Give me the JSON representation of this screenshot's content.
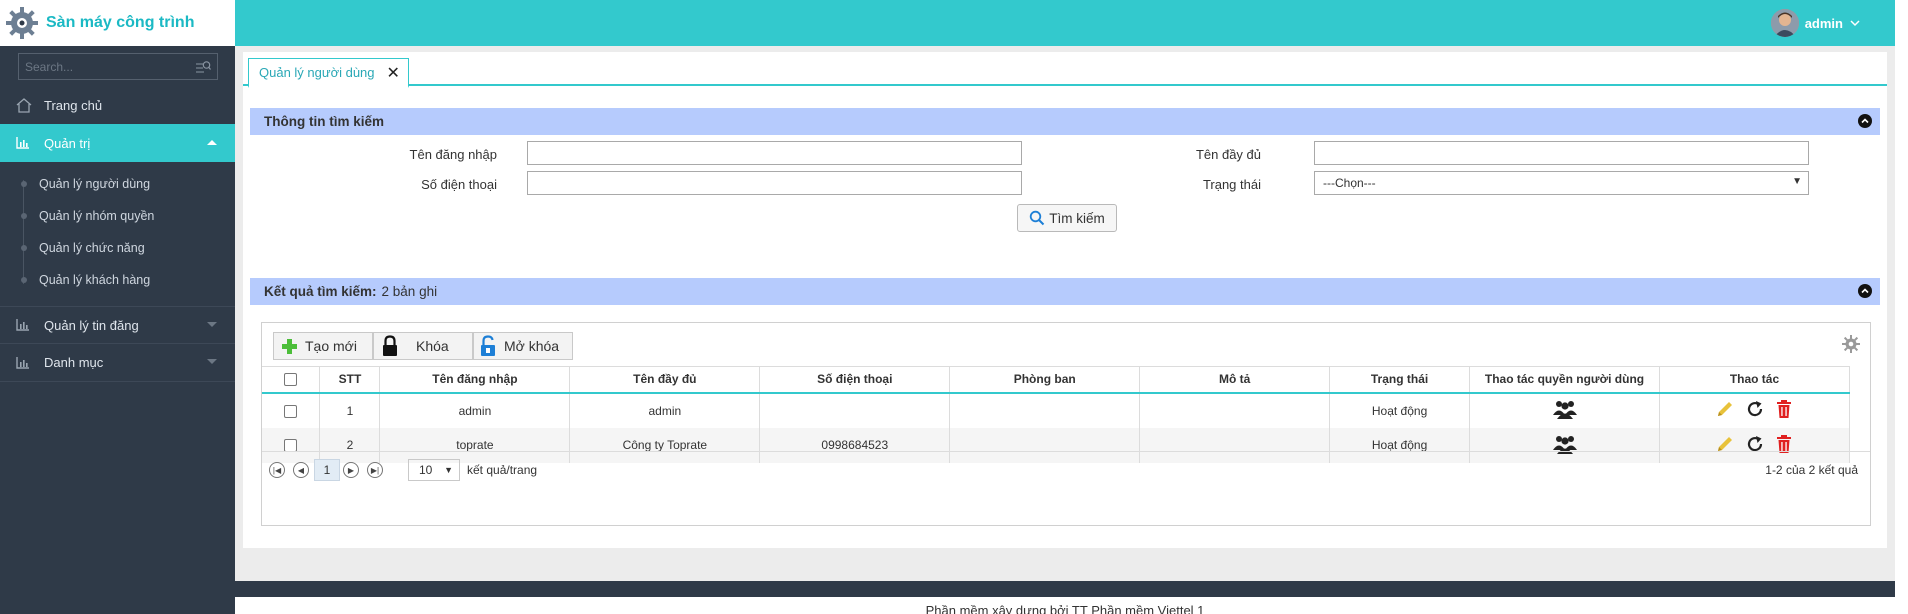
{
  "app": {
    "title": "Sàn máy công trình"
  },
  "sidebar": {
    "search_placeholder": "Search...",
    "items": [
      {
        "label": "Trang chủ"
      },
      {
        "label": "Quản trị",
        "children": [
          {
            "label": "Quản lý người dùng"
          },
          {
            "label": "Quản lý nhóm quyền"
          },
          {
            "label": "Quản lý chức năng"
          },
          {
            "label": "Quản lý khách hàng"
          }
        ]
      },
      {
        "label": "Quản lý tin đăng"
      },
      {
        "label": "Danh mục"
      }
    ]
  },
  "header": {
    "username": "admin"
  },
  "tab": {
    "label": "Quản lý người dùng"
  },
  "search_section": {
    "title": "Thông tin tìm kiếm",
    "fields": {
      "username_label": "Tên đăng nhập",
      "fullname_label": "Tên đầy đủ",
      "phone_label": "Số điện thoại",
      "status_label": "Trạng thái",
      "status_value": "---Chọn---"
    },
    "search_button": "Tìm kiếm"
  },
  "results_section": {
    "title": "Kết quả tìm kiếm:",
    "count_text": "2 bản ghi"
  },
  "toolbar": {
    "create": "Tạo mới",
    "lock": "Khóa",
    "unlock": "Mở khóa"
  },
  "table": {
    "columns": [
      "STT",
      "Tên đăng nhập",
      "Tên đầy đủ",
      "Số điện thoại",
      "Phòng ban",
      "Mô tả",
      "Trạng thái",
      "Thao tác quyền người dùng",
      "Thao tác"
    ],
    "rows": [
      {
        "stt": "1",
        "username": "admin",
        "fullname": "admin",
        "phone": "",
        "department": "",
        "description": "",
        "status": "Hoạt động"
      },
      {
        "stt": "2",
        "username": "toprate",
        "fullname": "Công ty Toprate",
        "phone": "0998684523",
        "department": "",
        "description": "",
        "status": "Hoạt động"
      }
    ]
  },
  "pager": {
    "current_page": "1",
    "page_size": "10",
    "page_size_label": "kết quả/trang",
    "summary": "1-2 của 2 kết quả"
  },
  "footer": {
    "text": "Phần mềm xây dựng bởi TT Phần mềm Viettel 1"
  },
  "colors": {
    "accent": "#33c9cd",
    "sidebar": "#2f3a48",
    "section_header": "#b6cbfd",
    "delete": "#e02020",
    "edit": "#e8c23a"
  }
}
